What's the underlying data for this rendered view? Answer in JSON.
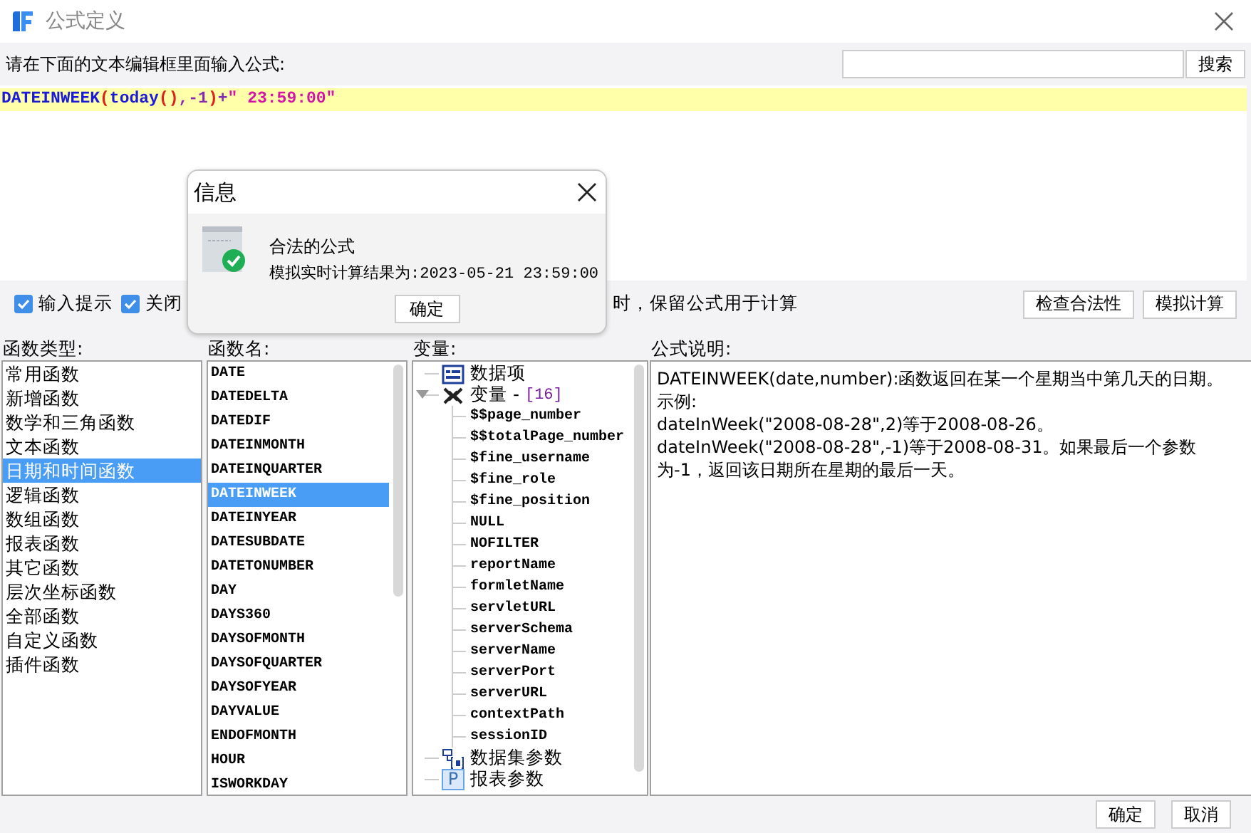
{
  "window": {
    "title": "公式定义"
  },
  "prompt": "请在下面的文本编辑框里面输入公式:",
  "search": {
    "button": "搜索"
  },
  "formula": [
    {
      "kind": "function",
      "text": "DATEINWEEK"
    },
    {
      "kind": "paren",
      "text": "("
    },
    {
      "kind": "function",
      "text": "today"
    },
    {
      "kind": "paren",
      "text": "()"
    },
    {
      "kind": "operator",
      "text": ",-1"
    },
    {
      "kind": "paren",
      "text": ")"
    },
    {
      "kind": "operator",
      "text": "+"
    },
    {
      "kind": "string",
      "text": "\" 23:59:00\""
    }
  ],
  "options": [
    {
      "label": "输入提示",
      "checked": true
    },
    {
      "label": "关闭",
      "checked": true
    }
  ],
  "options_tail": "时，保留公式用于计算",
  "actions": [
    "检查合法性",
    "模拟计算"
  ],
  "function_types": {
    "label": "函数类型:",
    "items": [
      {
        "label": "常用函数",
        "selected": false
      },
      {
        "label": "新增函数",
        "selected": false
      },
      {
        "label": "数学和三角函数",
        "selected": false
      },
      {
        "label": "文本函数",
        "selected": false
      },
      {
        "label": "日期和时间函数",
        "selected": true
      },
      {
        "label": "逻辑函数",
        "selected": false
      },
      {
        "label": "数组函数",
        "selected": false
      },
      {
        "label": "报表函数",
        "selected": false
      },
      {
        "label": "其它函数",
        "selected": false
      },
      {
        "label": "层次坐标函数",
        "selected": false
      },
      {
        "label": "全部函数",
        "selected": false
      },
      {
        "label": "自定义函数",
        "selected": false
      },
      {
        "label": "插件函数",
        "selected": false
      }
    ]
  },
  "function_names": {
    "label": "函数名:",
    "items": [
      {
        "label": "DATE",
        "selected": false
      },
      {
        "label": "DATEDELTA",
        "selected": false
      },
      {
        "label": "DATEDIF",
        "selected": false
      },
      {
        "label": "DATEINMONTH",
        "selected": false
      },
      {
        "label": "DATEINQUARTER",
        "selected": false
      },
      {
        "label": "DATEINWEEK",
        "selected": true
      },
      {
        "label": "DATEINYEAR",
        "selected": false
      },
      {
        "label": "DATESUBDATE",
        "selected": false
      },
      {
        "label": "DATETONUMBER",
        "selected": false
      },
      {
        "label": "DAY",
        "selected": false
      },
      {
        "label": "DAYS360",
        "selected": false
      },
      {
        "label": "DAYSOFMONTH",
        "selected": false
      },
      {
        "label": "DAYSOFQUARTER",
        "selected": false
      },
      {
        "label": "DAYSOFYEAR",
        "selected": false
      },
      {
        "label": "DAYVALUE",
        "selected": false
      },
      {
        "label": "ENDOFMONTH",
        "selected": false
      },
      {
        "label": "HOUR",
        "selected": false
      },
      {
        "label": "ISWORKDAY",
        "selected": false
      }
    ]
  },
  "variables": {
    "label": "变量:",
    "items": [
      {
        "kind": "data_item",
        "label": "数据项"
      },
      {
        "kind": "variable_group",
        "label": "变量 -",
        "count": "[16]",
        "expanded": true,
        "children": [
          {
            "label": "$$page_number"
          },
          {
            "label": "$$totalPage_number"
          },
          {
            "label": "$fine_username"
          },
          {
            "label": "$fine_role"
          },
          {
            "label": "$fine_position"
          },
          {
            "label": "NULL"
          },
          {
            "label": "NOFILTER"
          },
          {
            "label": "reportName"
          },
          {
            "label": "formletName"
          },
          {
            "label": "servletURL"
          },
          {
            "label": "serverSchema"
          },
          {
            "label": "serverName"
          },
          {
            "label": "serverPort"
          },
          {
            "label": "serverURL"
          },
          {
            "label": "contextPath"
          },
          {
            "label": "sessionID"
          }
        ]
      },
      {
        "kind": "dataset_parameters",
        "label": "数据集参数"
      },
      {
        "kind": "report_parameters",
        "label": "报表参数",
        "badge": "P"
      }
    ]
  },
  "description": {
    "label": "公式说明:",
    "lines": [
      "DATEINWEEK(date,number):函数返回在某一个星期当中第几天的日期。",
      "示例:",
      "dateInWeek(\"2008-08-28\",2)等于2008-08-26。",
      "dateInWeek(\"2008-08-28\",-1)等于2008-08-31。如果最后一个参数为-1，返回该日期所在星期的最后一天。"
    ]
  },
  "footer_buttons": [
    "确定",
    "取消"
  ],
  "dialog": {
    "title": "信息",
    "heading": "合法的公式",
    "result": "模拟实时计算结果为:2023-05-21 23:59:00",
    "button": "确定"
  }
}
